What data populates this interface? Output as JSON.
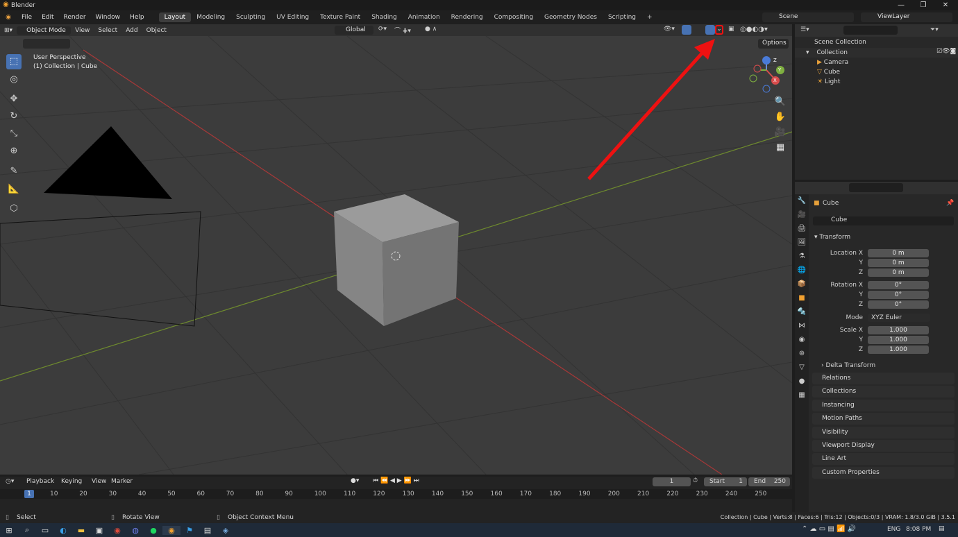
{
  "window": {
    "title": "Blender",
    "minimize": "—",
    "maximize": "❐",
    "close": "✕"
  },
  "menubar": {
    "menus": [
      "File",
      "Edit",
      "Render",
      "Window",
      "Help"
    ],
    "workspaces": [
      "Layout",
      "Modeling",
      "Sculpting",
      "UV Editing",
      "Texture Paint",
      "Shading",
      "Animation",
      "Rendering",
      "Compositing",
      "Geometry Nodes",
      "Scripting"
    ],
    "add_tab": "+",
    "scene_label": "Scene",
    "viewlayer_label": "ViewLayer"
  },
  "viewport_header": {
    "mode": "Object Mode",
    "menus": [
      "View",
      "Select",
      "Add",
      "Object"
    ],
    "orientation": "Global",
    "options_label": "Options"
  },
  "viewport": {
    "overlay_line1": "User Perspective",
    "overlay_line2": "(1) Collection | Cube",
    "gizmo_x": "X",
    "gizmo_y": "Y",
    "gizmo_z": "Z",
    "annotation_color": "#ee1111"
  },
  "outliner": {
    "root": "Scene Collection",
    "collection": "Collection",
    "items": [
      "Camera",
      "Cube",
      "Light"
    ]
  },
  "properties": {
    "object_name": "Cube",
    "data_name": "Cube",
    "transform_label": "Transform",
    "location_label": "Location X",
    "rotation_label": "Rotation X",
    "scale_label": "Scale X",
    "y_label": "Y",
    "z_label": "Z",
    "location": [
      "0 m",
      "0 m",
      "0 m"
    ],
    "rotation": [
      "0°",
      "0°",
      "0°"
    ],
    "mode_label": "Mode",
    "mode_value": "XYZ Euler",
    "scale": [
      "1.000",
      "1.000",
      "1.000"
    ],
    "delta": "Delta Transform",
    "panels": [
      "Relations",
      "Collections",
      "Instancing",
      "Motion Paths",
      "Visibility",
      "Viewport Display",
      "Line Art",
      "Custom Properties"
    ]
  },
  "timeline": {
    "menus": [
      "Playback",
      "Keying",
      "View",
      "Marker"
    ],
    "current_frame": "1",
    "start_label": "Start",
    "start_value": "1",
    "end_label": "End",
    "end_value": "250",
    "ruler": [
      "10",
      "20",
      "30",
      "40",
      "50",
      "60",
      "70",
      "80",
      "90",
      "100",
      "110",
      "120",
      "130",
      "140",
      "150",
      "160",
      "170",
      "180",
      "190",
      "200",
      "210",
      "220",
      "230",
      "240",
      "250"
    ],
    "playhead": "1"
  },
  "statusbar": {
    "select": "Select",
    "rotate": "Rotate View",
    "context": "Object Context Menu",
    "info": "Collection | Cube | Verts:8 | Faces:6 | Tris:12 | Objects:0/3 | VRAM: 1.8/3.0 GiB | 3.5.1"
  },
  "taskbar": {
    "lang": "ENG",
    "time": "8:08 PM"
  }
}
